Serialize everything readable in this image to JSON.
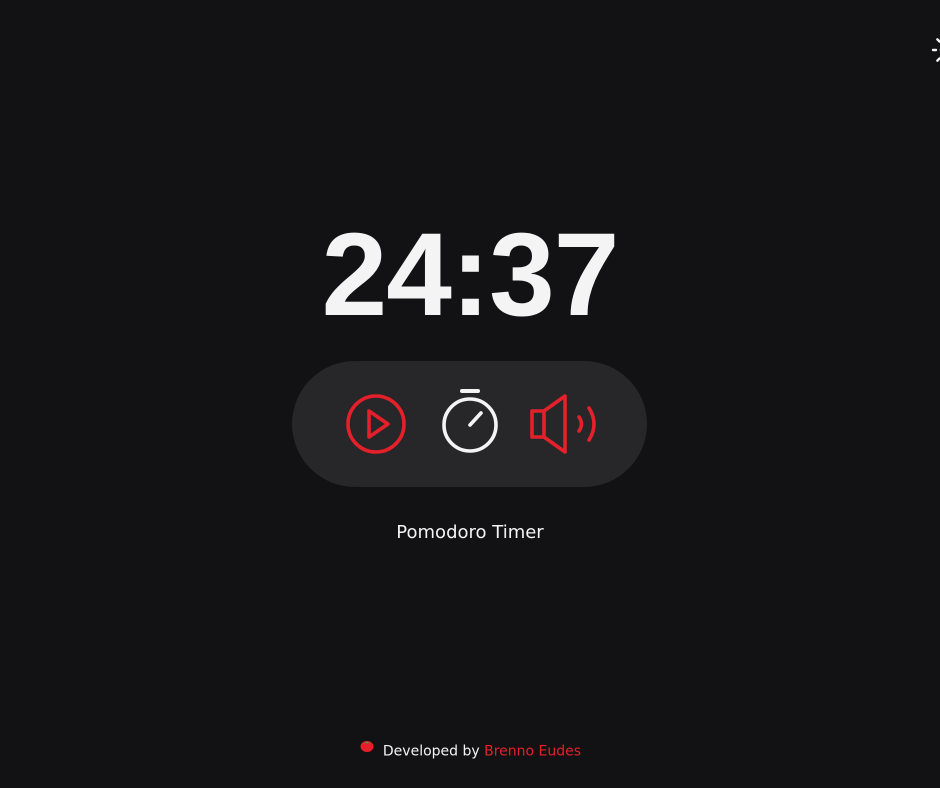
{
  "timer": {
    "display": "24:37"
  },
  "subtitle": "Pomodoro Timer",
  "footer": {
    "prefix": "Developed by",
    "author": "Brenno Eudes"
  },
  "icons": {
    "theme_toggle": "sun-icon",
    "play": "play-icon",
    "timer": "stopwatch-icon",
    "sound": "speaker-icon",
    "footer_logo": "tomato-icon"
  },
  "colors": {
    "background": "#121214",
    "panel": "#272729",
    "accent": "#e5202a",
    "text": "#f4f4f5"
  }
}
